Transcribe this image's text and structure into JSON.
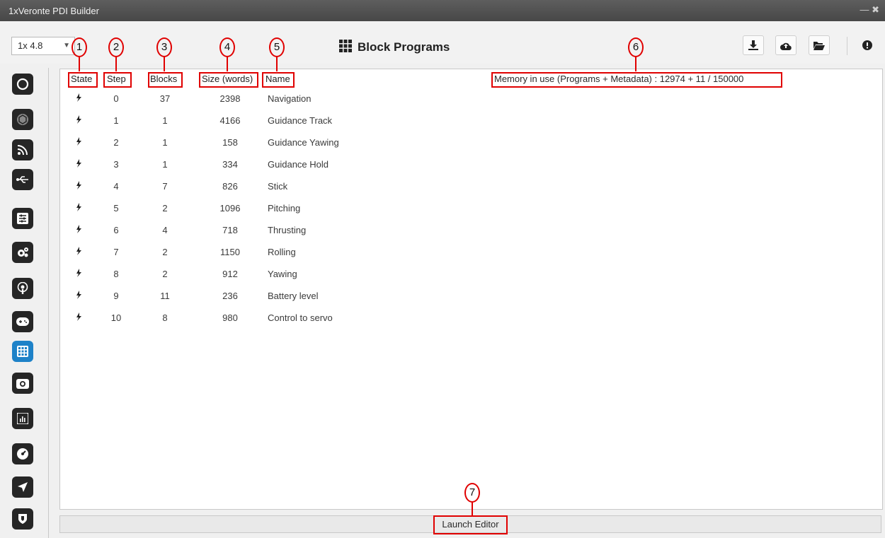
{
  "window": {
    "title": "1xVeronte PDI Builder",
    "controls": "— ✖"
  },
  "toolbar": {
    "version": "1x 4.8",
    "page_title": "Block Programs",
    "buttons": [
      "download-icon",
      "cloud-upload-icon",
      "folder-open-icon",
      "info-icon"
    ]
  },
  "sidebar": {
    "items": [
      {
        "icon": "power-icon",
        "active": false
      },
      {
        "icon": "hexagon-icon",
        "active": false
      },
      {
        "icon": "rss-icon",
        "active": false
      },
      {
        "icon": "usb-icon",
        "active": false
      },
      {
        "icon": "sliders-icon",
        "active": false
      },
      {
        "icon": "gears-icon",
        "active": false
      },
      {
        "icon": "podcast-icon",
        "active": false
      },
      {
        "icon": "gamepad-icon",
        "active": false
      },
      {
        "icon": "grid-icon",
        "active": true
      },
      {
        "icon": "camera-icon",
        "active": false
      },
      {
        "icon": "chart-icon",
        "active": false
      },
      {
        "icon": "dashboard-icon",
        "active": false
      },
      {
        "icon": "plane-icon",
        "active": false
      },
      {
        "icon": "shield-icon",
        "active": false
      }
    ]
  },
  "table": {
    "headers": {
      "state": "State",
      "step": "Step",
      "blocks": "Blocks",
      "size": "Size (words)",
      "name": "Name"
    },
    "memory": "Memory in use (Programs + Metadata) : 12974 + 11 / 150000",
    "rows": [
      {
        "step": "0",
        "blocks": "37",
        "size": "2398",
        "name": "Navigation"
      },
      {
        "step": "1",
        "blocks": "1",
        "size": "4166",
        "name": "Guidance Track"
      },
      {
        "step": "2",
        "blocks": "1",
        "size": "158",
        "name": "Guidance Yawing"
      },
      {
        "step": "3",
        "blocks": "1",
        "size": "334",
        "name": "Guidance Hold"
      },
      {
        "step": "4",
        "blocks": "7",
        "size": "826",
        "name": "Stick"
      },
      {
        "step": "5",
        "blocks": "2",
        "size": "1096",
        "name": "Pitching"
      },
      {
        "step": "6",
        "blocks": "4",
        "size": "718",
        "name": "Thrusting"
      },
      {
        "step": "7",
        "blocks": "2",
        "size": "1150",
        "name": "Rolling"
      },
      {
        "step": "8",
        "blocks": "2",
        "size": "912",
        "name": "Yawing"
      },
      {
        "step": "9",
        "blocks": "11",
        "size": "236",
        "name": "Battery level"
      },
      {
        "step": "10",
        "blocks": "8",
        "size": "980",
        "name": "Control to servo"
      }
    ]
  },
  "footer": {
    "launch_label": "Launch Editor"
  },
  "callouts": [
    "1",
    "2",
    "3",
    "4",
    "5",
    "6",
    "7"
  ],
  "colors": {
    "annotation": "#e00000",
    "active_nav": "#1e82c8",
    "nav_icon_bg": "#262626"
  }
}
